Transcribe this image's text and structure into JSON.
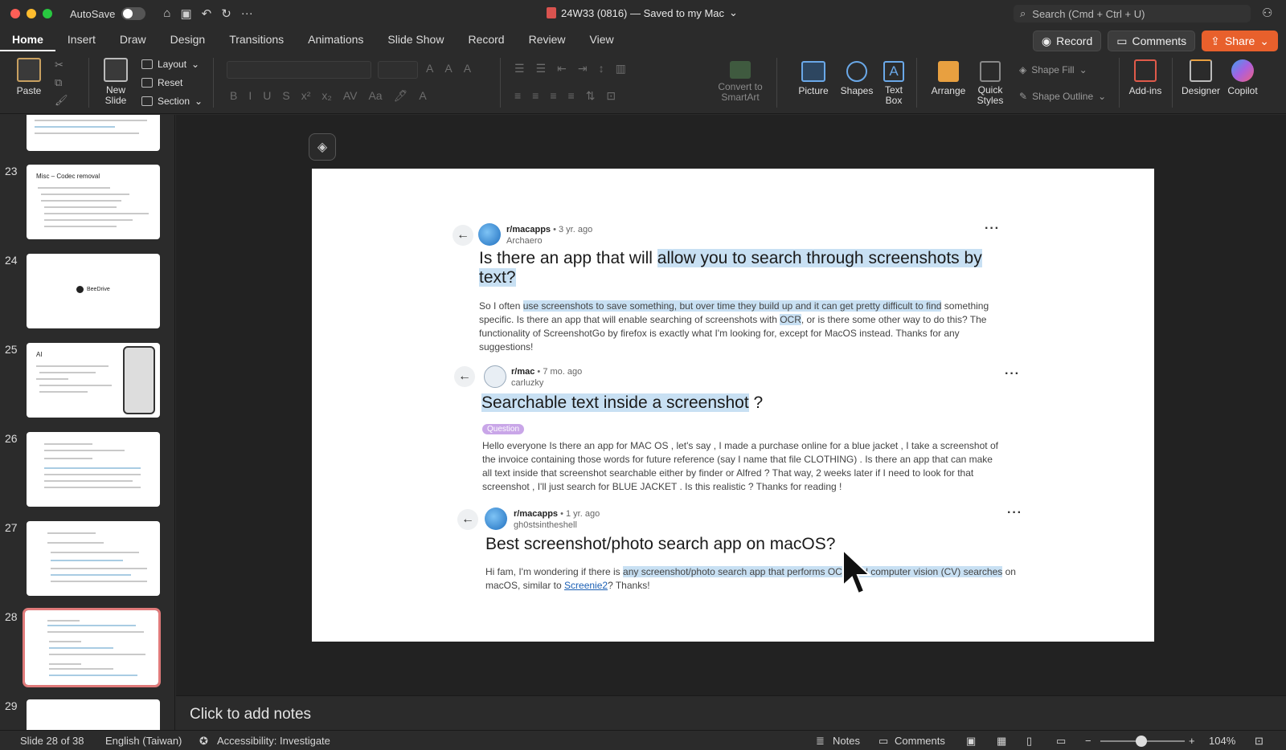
{
  "titlebar": {
    "autosave_label": "AutoSave",
    "doc_title": "24W33 (0816) — Saved to my Mac",
    "search_placeholder": "Search (Cmd + Ctrl + U)"
  },
  "tabs": [
    "Home",
    "Insert",
    "Draw",
    "Design",
    "Transitions",
    "Animations",
    "Slide Show",
    "Record",
    "Review",
    "View"
  ],
  "active_tab": "Home",
  "ribbon_actions": {
    "record": "Record",
    "comments": "Comments",
    "share": "Share"
  },
  "ribbon": {
    "paste": "Paste",
    "new_slide": "New\nSlide",
    "layout": "Layout",
    "reset": "Reset",
    "section": "Section",
    "convert_smartart": "Convert to\nSmartArt",
    "picture": "Picture",
    "shapes": "Shapes",
    "text_box": "Text\nBox",
    "arrange": "Arrange",
    "quick_styles": "Quick\nStyles",
    "shape_fill": "Shape Fill",
    "shape_outline": "Shape Outline",
    "add_ins": "Add-ins",
    "designer": "Designer",
    "copilot": "Copilot"
  },
  "slides": [
    {
      "num": "23",
      "title": "Misc – Codec removal"
    },
    {
      "num": "24",
      "title": "BeeDrive"
    },
    {
      "num": "25",
      "title": "AI"
    },
    {
      "num": "26",
      "title": ""
    },
    {
      "num": "27",
      "title": ""
    },
    {
      "num": "28",
      "title": ""
    },
    {
      "num": "29",
      "title": ""
    }
  ],
  "posts": [
    {
      "subreddit": "r/macapps",
      "age": "• 3 yr. ago",
      "user": "Archaero",
      "title_plain": "Is there an app that will ",
      "title_hl": "allow you to search through screenshots by text?",
      "body_pre": "So I often ",
      "body_hl": "use screenshots to save something, but over time they build up and it can get pretty difficult to find",
      "body_mid": " something specific. Is there an app that will enable searching of screenshots with ",
      "body_hl2": "OCR",
      "body_post": ", or is there some other way to do this? The functionality of ScreenshotGo by firefox is exactly what I'm looking for, except for MacOS instead. Thanks for any suggestions!"
    },
    {
      "subreddit": "r/mac",
      "age": "• 7 mo. ago",
      "user": "carluzky",
      "title_hl": "Searchable text inside a screenshot",
      "title_tail": " ?",
      "tag": "Question",
      "body": "Hello everyone Is there an app for MAC OS , let's say , I made a purchase online for a blue jacket , I take a screenshot of the invoice containing those words for future reference (say I name that file CLOTHING) . Is there an app that can make all text inside that screenshot searchable either by finder or Alfred ? That way, 2 weeks later if I need to look for that screenshot , I'll just search for BLUE JACKET . Is this realistic ? Thanks for reading !"
    },
    {
      "subreddit": "r/macapps",
      "age": "• 1 yr. ago",
      "user": "gh0stsintheshell",
      "title": "Best screenshot/photo search app on macOS?",
      "body_pre": "Hi fam, I'm wondering if there is ",
      "body_hl": "any screenshot/photo search app that performs OCR and computer vision (CV) searches",
      "body_mid": " on macOS, similar to ",
      "body_link": "Screenie2",
      "body_post": "? Thanks!"
    }
  ],
  "notes_placeholder": "Click to add notes",
  "status": {
    "slide_info": "Slide 28 of 38",
    "language": "English (Taiwan)",
    "accessibility": "Accessibility: Investigate",
    "notes": "Notes",
    "comments": "Comments",
    "zoom": "104%"
  },
  "colors": {
    "accent_share": "#e8602c",
    "highlight": "#c8e0f3",
    "selected_thumb": "#e07a7a"
  }
}
